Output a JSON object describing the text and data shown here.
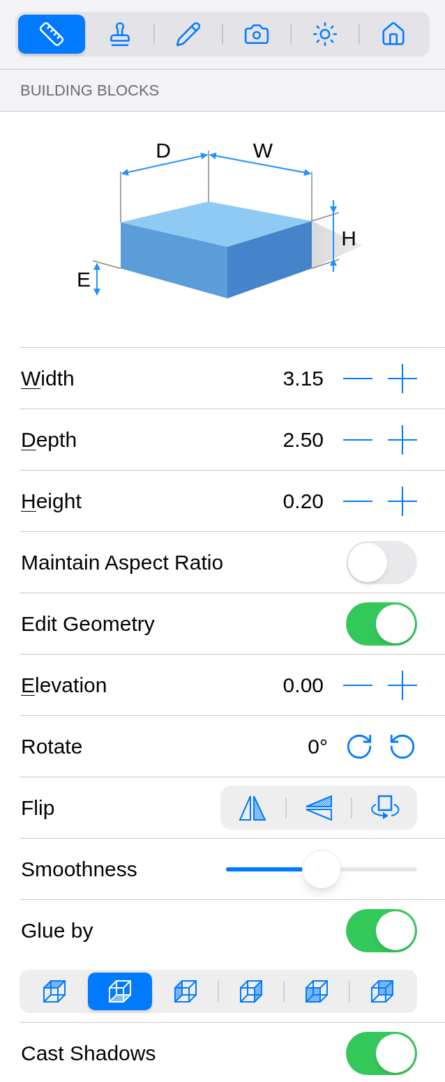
{
  "toolbar": {
    "tabs": [
      {
        "selected": true
      },
      {
        "selected": false
      },
      {
        "selected": false
      },
      {
        "selected": false
      },
      {
        "selected": false
      },
      {
        "selected": false
      }
    ]
  },
  "section_header": "BUILDING BLOCKS",
  "diagram": {
    "labels": [
      "D",
      "W",
      "H",
      "E"
    ]
  },
  "rows": [
    {
      "kind": "stepper",
      "label": "Width",
      "mnemonic": true,
      "value": "3.15"
    },
    {
      "kind": "stepper",
      "label": "Depth",
      "mnemonic": true,
      "value": "2.50"
    },
    {
      "kind": "stepper",
      "label": "Height",
      "mnemonic": true,
      "value": "0.20"
    },
    {
      "kind": "toggle",
      "label": "Maintain Aspect Ratio",
      "on": false
    },
    {
      "kind": "toggle",
      "label": "Edit Geometry",
      "on": true
    },
    {
      "kind": "stepper",
      "label": "Elevation",
      "mnemonic": true,
      "value": "0.00"
    },
    {
      "kind": "rotate",
      "label": "Rotate",
      "value": "0°"
    },
    {
      "kind": "flip",
      "label": "Flip"
    },
    {
      "kind": "slider",
      "label": "Smoothness",
      "level": 0.5
    },
    {
      "kind": "toggle",
      "label": "Glue by",
      "on": true
    },
    {
      "kind": "options",
      "options": [
        {
          "selected": false
        },
        {
          "selected": true
        },
        {
          "selected": false
        },
        {
          "selected": false
        },
        {
          "selected": false
        },
        {
          "selected": false
        }
      ]
    },
    {
      "kind": "toggle",
      "label": "Cast Shadows",
      "on": true
    }
  ]
}
